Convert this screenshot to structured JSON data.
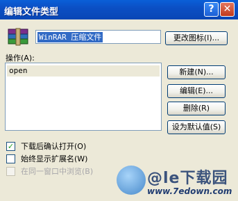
{
  "window": {
    "title": "编辑文件类型",
    "help_icon": "help-icon",
    "close_icon": "close-icon"
  },
  "file_type": {
    "icon": "winrar-archive-icon",
    "name_value": "WinRAR 压缩文件",
    "change_icon_button": "更改图标(I)..."
  },
  "actions": {
    "label": "操作(A):",
    "items": [
      "open"
    ],
    "buttons": {
      "new": "新建(N)...",
      "edit": "编辑(E)...",
      "delete": "删除(R)",
      "set_default": "设为默认值(S)"
    }
  },
  "options": [
    {
      "label": "下载后确认打开(O)",
      "checked": true,
      "enabled": true
    },
    {
      "label": "始终显示扩展名(W)",
      "checked": false,
      "enabled": true
    },
    {
      "label": "在同一窗口中浏览(B)",
      "checked": false,
      "enabled": false
    }
  ],
  "watermark": {
    "title": "@le下载园",
    "url": "www.7edown.com"
  },
  "colors": {
    "titlebar": "#0b4fc4",
    "dialog_bg": "#ece9d8",
    "selection": "#316ac5"
  }
}
